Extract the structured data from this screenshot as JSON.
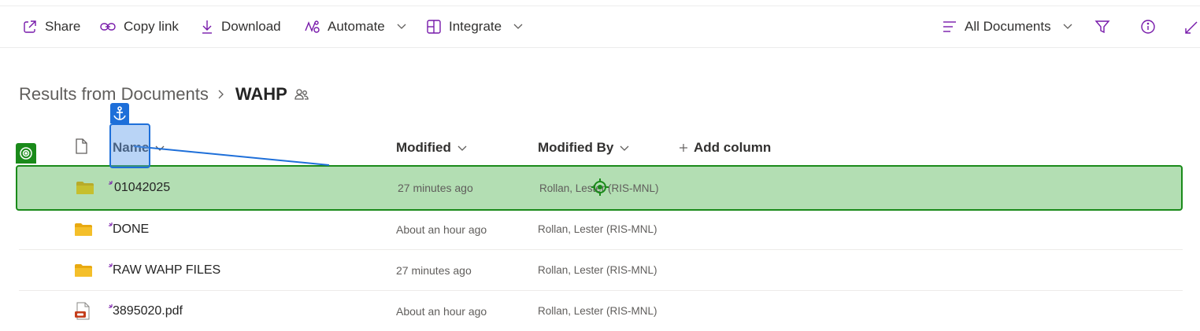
{
  "toolbar": {
    "share_label": "Share",
    "copy_link_label": "Copy link",
    "download_label": "Download",
    "automate_label": "Automate",
    "integrate_label": "Integrate",
    "view_label": "All Documents"
  },
  "breadcrumb": {
    "parent": "Results from Documents",
    "current": "WAHP"
  },
  "columns": {
    "name": "Name",
    "modified": "Modified",
    "modified_by": "Modified By",
    "add_column": "Add column"
  },
  "rows": [
    {
      "name": "01042025",
      "modified": "27 minutes ago",
      "modified_by": "Rollan, Lester (RIS-MNL)",
      "type": "folder",
      "icon": "folder-icon"
    },
    {
      "name": "DONE",
      "modified": "About an hour ago",
      "modified_by": "Rollan, Lester (RIS-MNL)",
      "type": "folder",
      "icon": "folder-icon"
    },
    {
      "name": "RAW WAHP FILES",
      "modified": "27 minutes ago",
      "modified_by": "Rollan, Lester (RIS-MNL)",
      "type": "folder",
      "icon": "folder-icon"
    },
    {
      "name": "3895020.pdf",
      "modified": "About an hour ago",
      "modified_by": "Rollan, Lester (RIS-MNL)",
      "type": "pdf",
      "icon": "pdf-file-icon"
    }
  ],
  "colors": {
    "accent": "#7719aa",
    "selection": "#b3deb3",
    "selection_border": "#1a8a1a",
    "anchor_overlay": "#1e6fd9",
    "folder": "#f4bf2a"
  }
}
